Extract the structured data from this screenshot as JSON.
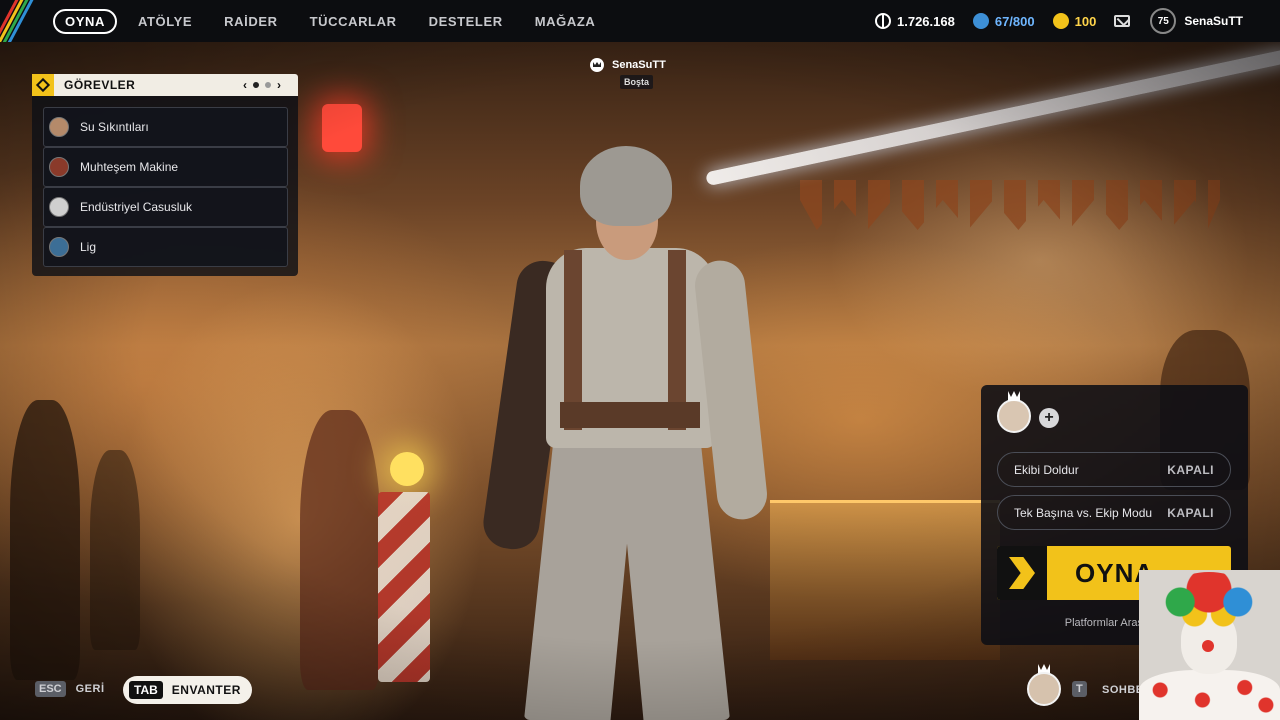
{
  "nav": {
    "items": [
      {
        "label": "OYNA",
        "active": true
      },
      {
        "label": "ATÖLYE",
        "active": false
      },
      {
        "label": "RAİDER",
        "active": false
      },
      {
        "label": "TÜCCARLAR",
        "active": false
      },
      {
        "label": "DESTELER",
        "active": false
      },
      {
        "label": "MAĞAZA",
        "active": false
      }
    ]
  },
  "currencies": {
    "coins": "1.726.168",
    "raider_tokens": "67/800",
    "credits": "100"
  },
  "profile": {
    "level": "75",
    "username": "SenaSuTT"
  },
  "quests": {
    "title": "GÖREVLER",
    "page_current": 1,
    "page_total": 2,
    "items": [
      {
        "label": "Su Sıkıntıları"
      },
      {
        "label": "Muhteşem Makine"
      },
      {
        "label": "Endüstriyel Casusluk"
      },
      {
        "label": "Lig"
      }
    ]
  },
  "player_tag": {
    "name": "SenaSuTT",
    "status": "Boşta"
  },
  "party": {
    "fill_team_label": "Ekibi Doldur",
    "fill_team_value": "KAPALI",
    "solo_mode_label": "Tek Başına vs. Ekip Modu",
    "solo_mode_value": "KAPALI",
    "play_label": "OYNA",
    "crossplay_text": "Platformlar Arası Oy"
  },
  "hints": {
    "esc_key": "ESC",
    "esc_label": "GERİ",
    "tab_key": "TAB",
    "tab_label": "ENVANTER",
    "chat_key": "T",
    "chat_label": "SOHBE"
  },
  "colors": {
    "accent_yellow": "#f2c21a",
    "raider_blue": "#6fb6ff",
    "credit_gold": "#ffd44a",
    "topbar_bg": "#0c0d10"
  },
  "icons": {
    "coin": "coin-icon",
    "raider": "raider-token-icon",
    "credits": "credits-icon",
    "mail": "mail-icon",
    "crown": "crown-icon",
    "quest": "quest-diamond-icon"
  }
}
